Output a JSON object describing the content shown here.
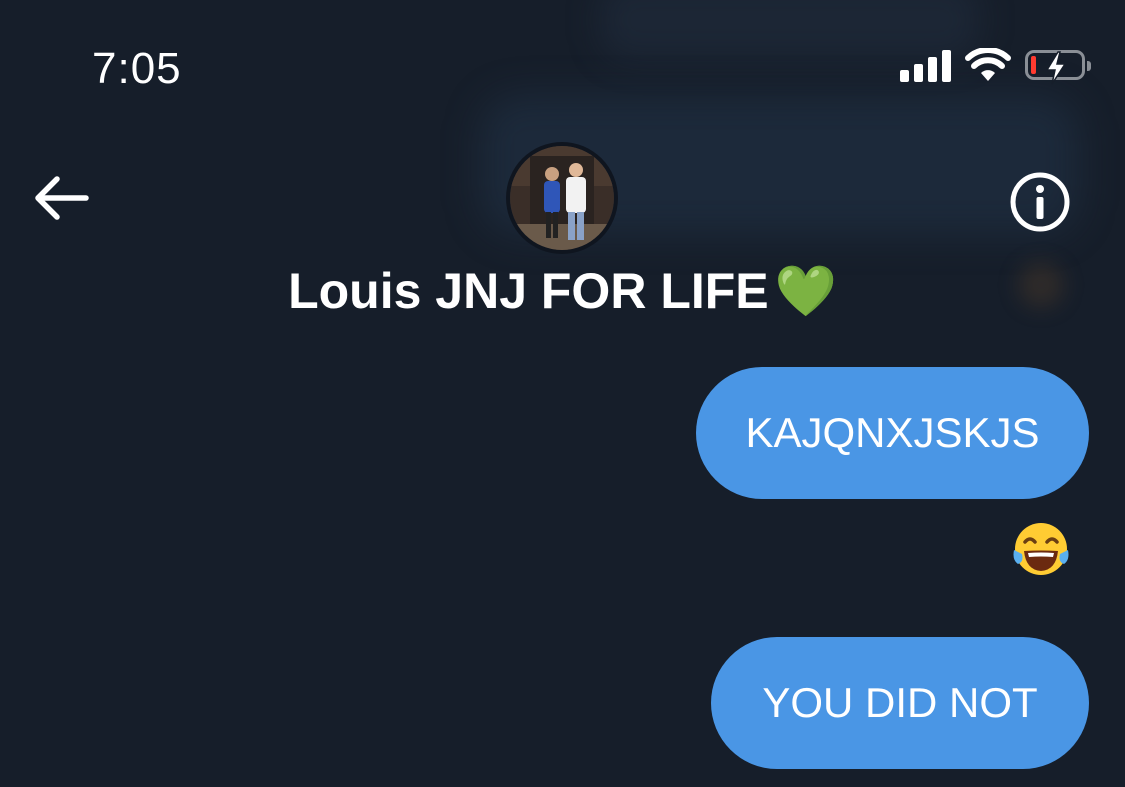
{
  "status_bar": {
    "time": "7:05",
    "icons": [
      "cellular-signal-icon",
      "wifi-icon",
      "battery-charging-icon"
    ],
    "battery_color": "#ff3b30"
  },
  "header": {
    "back_icon": "back-arrow-icon",
    "info_icon": "info-icon",
    "contact_name": "Louis JNJ FOR LIFE",
    "name_emoji": "💚"
  },
  "messages": [
    {
      "text": "KAJQNXJSKJS",
      "sender": "me"
    },
    {
      "reaction": "😂"
    },
    {
      "text": "YOU DID NOT",
      "sender": "me"
    }
  ],
  "colors": {
    "background": "#161e2a",
    "bubble_sent": "#4a96e5",
    "text": "#ffffff"
  }
}
